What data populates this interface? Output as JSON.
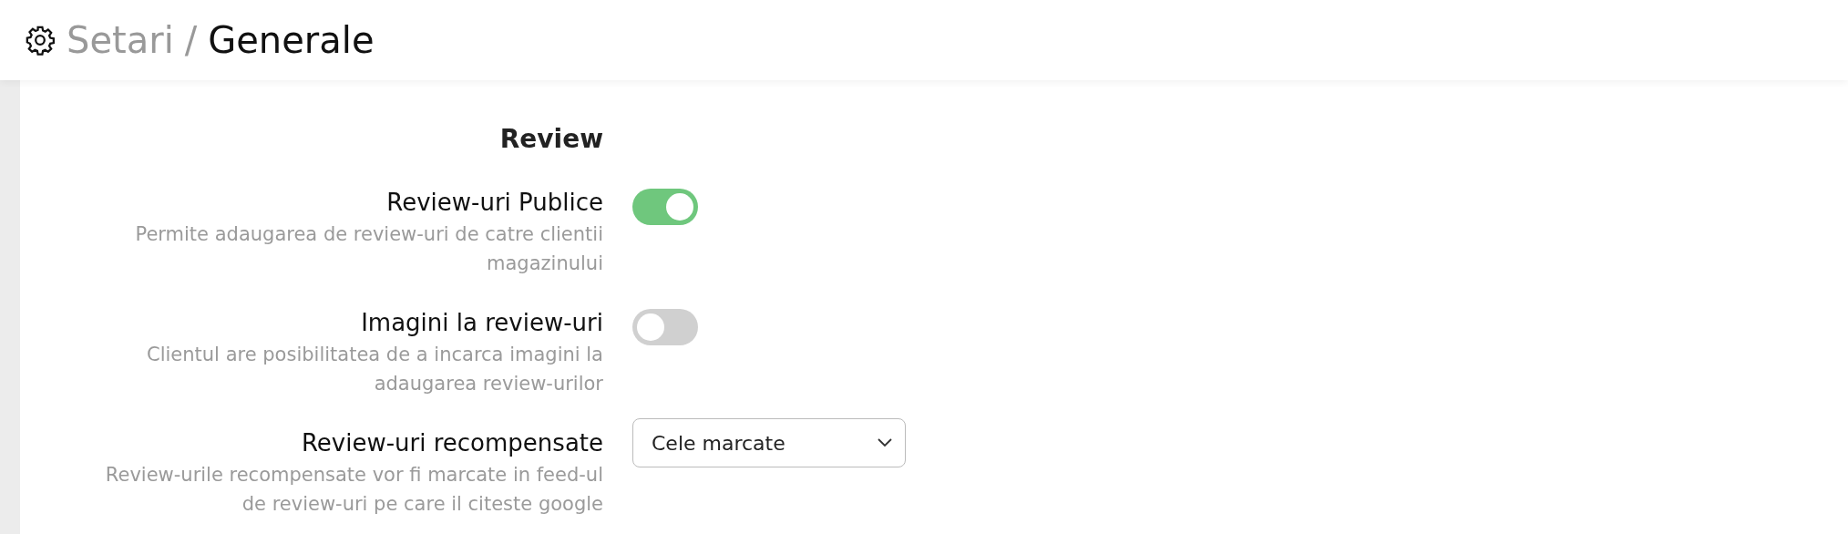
{
  "header": {
    "parent": "Setari",
    "separator": "/",
    "current": "Generale"
  },
  "section": {
    "title": "Review",
    "settings": [
      {
        "kind": "toggle",
        "label": "Review-uri Publice",
        "description": "Permite adaugarea de review-uri de catre clientii magazinului",
        "on": true
      },
      {
        "kind": "toggle",
        "label": "Imagini la review-uri",
        "description": "Clientul are posibilitatea de a incarca imagini la adaugarea review-urilor",
        "on": false
      },
      {
        "kind": "select",
        "label": "Review-uri recompensate",
        "description": "Review-urile recompensate vor fi marcate in feed-ul de review-uri pe care il citeste google",
        "value": "Cele marcate"
      }
    ]
  }
}
